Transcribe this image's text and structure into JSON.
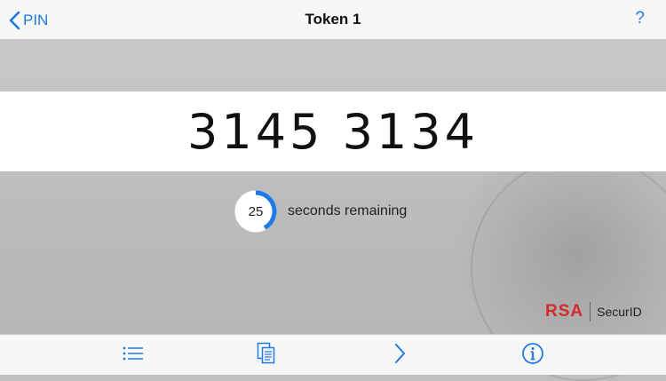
{
  "navbar": {
    "back_label": "PIN",
    "title": "Token 1",
    "help_label": "?"
  },
  "token": {
    "code": "3145 3134"
  },
  "timer": {
    "seconds": "25",
    "label": "seconds remaining",
    "progress_fraction": 0.42,
    "ring_color": "#1e7ae6"
  },
  "branding": {
    "mark": "RSA",
    "product": "SecurID",
    "mark_color": "#d42a2a"
  },
  "toolbar": {
    "items": [
      {
        "icon": "list-icon"
      },
      {
        "icon": "copy-icon"
      },
      {
        "icon": "next-chevron-icon"
      },
      {
        "icon": "info-icon"
      }
    ]
  },
  "colors": {
    "accent": "#1e7ae6"
  }
}
